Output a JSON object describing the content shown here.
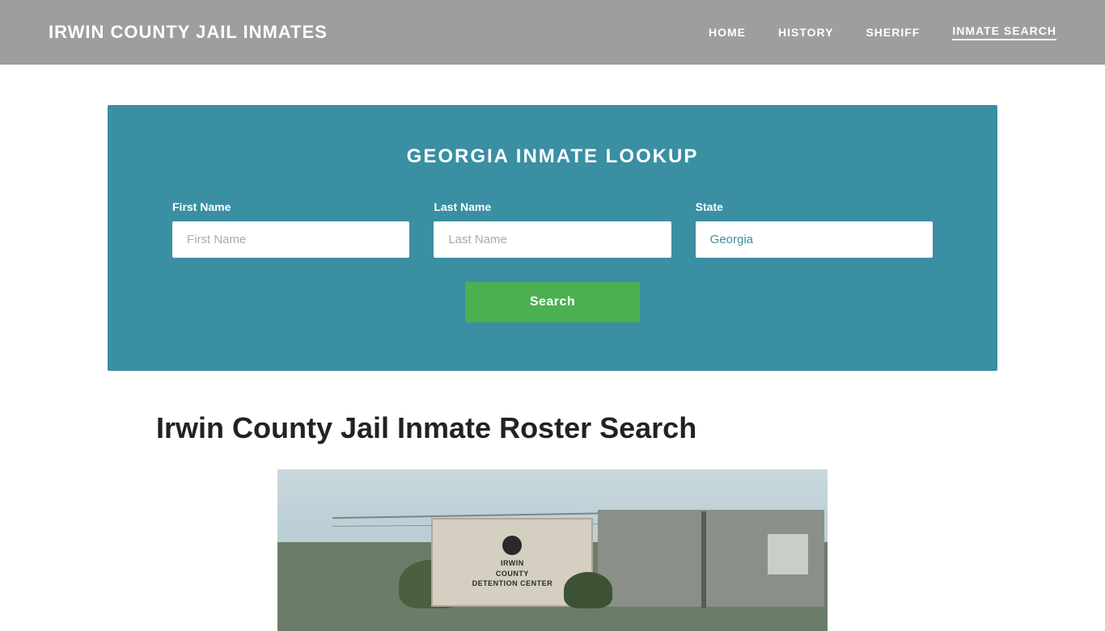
{
  "header": {
    "site_title": "IRWIN COUNTY JAIL INMATES",
    "nav": {
      "home": "HOME",
      "history": "HISTORY",
      "sheriff": "SHERIFF",
      "inmate_search": "INMATE SEARCH"
    }
  },
  "search_form": {
    "title": "GEORGIA INMATE LOOKUP",
    "first_name_label": "First Name",
    "first_name_placeholder": "First Name",
    "last_name_label": "Last Name",
    "last_name_placeholder": "Last Name",
    "state_label": "State",
    "state_value": "Georgia",
    "search_button_label": "Search"
  },
  "main": {
    "section_title": "Irwin County Jail Inmate Roster Search"
  }
}
